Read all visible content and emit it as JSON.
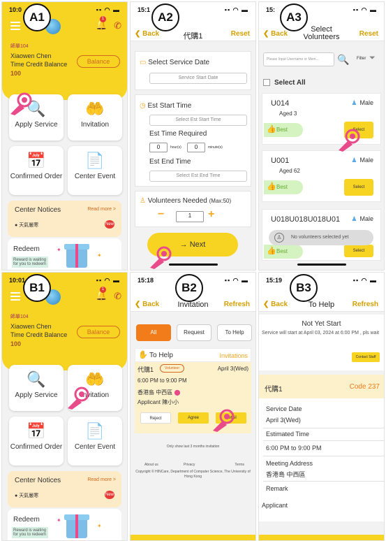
{
  "a1": {
    "marker": "A1",
    "status_time": "10:0",
    "user_id": "師單104",
    "user_name": "Xiaowen Chen",
    "balance_label": "Time Credit Balance",
    "balance_value": "100",
    "balance_button": "Balance",
    "tiles": {
      "apply": "Apply Service",
      "invitation": "Invitation",
      "confirmed": "Confirmed Order",
      "center_event": "Center Event"
    },
    "notice_title": "Center Notices",
    "notice_more": "Read more >",
    "notice_item": "天氣嚴寒",
    "notice_badge": "New",
    "redeem_title": "Redeem",
    "redeem_sub": "Reward is waiting for you to redeem"
  },
  "a2": {
    "marker": "A2",
    "status_time": "15:1",
    "back": "Back",
    "title": "代購1",
    "reset": "Reset",
    "service_date_label": "Select Service Date",
    "service_date_placeholder": "Service Start Date",
    "est_start_label": "Est Start Time",
    "est_start_placeholder": "Select Est Start Time",
    "est_required_label": "Est Time Required",
    "hours_value": "0",
    "hours_unit": "hour(s)",
    "minutes_value": "0",
    "minutes_unit": "minute(s)",
    "est_end_label": "Est End Time",
    "est_end_placeholder": "Select Est End Time",
    "volunteers_label": "Volunteers Needed",
    "volunteers_max": "(Max:50)",
    "volunteers_value": "1",
    "next_button": "→ Next"
  },
  "a3": {
    "marker": "A3",
    "status_time": "15:",
    "back": "Back",
    "title": "Select Volunteers",
    "reset": "Reset",
    "search_placeholder": "Please Input Username or Mem...",
    "filter": "Filter",
    "select_all": "Select All",
    "volunteers": [
      {
        "name": "U014",
        "age": "Aged 3",
        "gender": "Male",
        "best": "Best",
        "select": "Select"
      },
      {
        "name": "U001",
        "age": "Aged 62",
        "gender": "Male",
        "best": "Best",
        "select": "Select"
      },
      {
        "name": "U018U018U018U01",
        "age": "",
        "gender": "Male",
        "best": "Best",
        "select": "Select"
      }
    ],
    "toast": "No volunteers selected yet"
  },
  "b1": {
    "marker": "B1",
    "status_time": "10:01",
    "user_id": "師單104",
    "user_name": "Xiaowen Chen",
    "balance_label": "Time Credit Balance",
    "balance_value": "100",
    "balance_button": "Balance",
    "tiles": {
      "apply": "Apply Service",
      "invitation": "Invitation",
      "confirmed": "Confirmed Order",
      "center_event": "Center Event"
    },
    "notice_title": "Center Notices",
    "notice_more": "Read more >",
    "notice_item": "天氣嚴寒",
    "notice_badge": "New",
    "redeem_title": "Redeem",
    "redeem_sub": "Reward is waiting for you to redeem"
  },
  "b2": {
    "marker": "B2",
    "status_time": "15:18",
    "back": "Back",
    "title": "Invitation",
    "refresh": "Refresh",
    "tabs": [
      "All",
      "Request",
      "To Help"
    ],
    "section_left": "To Help",
    "section_right": "Invitations",
    "card_title": "代購1",
    "card_pill": "Volunteer",
    "card_date": "April 3(Wed)",
    "card_time": "6:00 PM to 9:00 PM",
    "card_location": "香港島 中西區",
    "card_applicant": "Applicant 陳小小",
    "reject": "Reject",
    "agree": "Agree",
    "detail": "Detail",
    "footnote": "Only show last 3 months invitation",
    "links": [
      "About us",
      "Privacy",
      "Terms"
    ],
    "copyright": "Copyright © HINCare, Department of Computer Science, The University of Hong Kong"
  },
  "b3": {
    "marker": "B3",
    "status_time": "15:19",
    "back": "Back",
    "title": "To Help",
    "refresh": "Refresh",
    "status_heading": "Not Yet Start",
    "status_desc": "Service will start at April 03, 2024 at 6:00 PM , pls wait",
    "contact_staff": "Contact Staff",
    "card_name": "代購1",
    "code": "Code 237",
    "service_date_label": "Service Date",
    "service_date_value": "April 3(Wed)",
    "est_time_label": "Estimated Time",
    "est_time_value": "6:00 PM to 9:00 PM",
    "meeting_label": "Meeting Address",
    "meeting_value": "香港島 中西區",
    "remark_label": "Remark",
    "applicant_label": "Applicant"
  },
  "colors": {
    "accent": "#f8d422",
    "orange": "#f27b1a",
    "pink": "#e84a8a"
  }
}
